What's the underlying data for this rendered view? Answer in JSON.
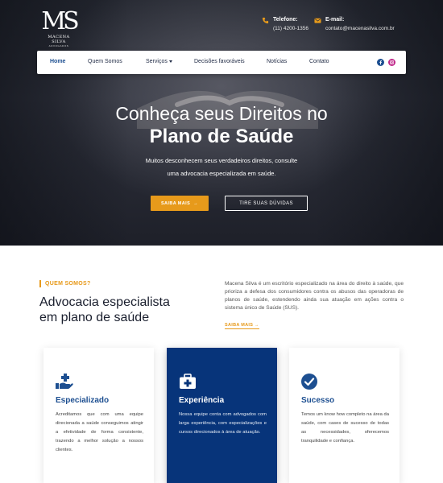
{
  "brand": {
    "mark": "MS",
    "name": "MACENA SILVA",
    "tagline": "ADVOGADOS"
  },
  "contacts": [
    {
      "label": "Telefone:",
      "value": "(11) 4200-1356",
      "icon": "phone-icon"
    },
    {
      "label": "E-mail:",
      "value": "contato@macenasilva.com.br",
      "icon": "mail-icon"
    }
  ],
  "nav": {
    "items": [
      "Home",
      "Quem Somos",
      "Serviços",
      "Decisões favoráveis",
      "Notícias",
      "Contato"
    ],
    "active": "Home",
    "social": [
      "facebook-icon",
      "instagram-icon"
    ]
  },
  "hero": {
    "title_line1": "Conheça seus Direitos no",
    "title_line2": "Plano de Saúde",
    "subtitle_line1": "Muitos desconhecem seus verdadeiros direitos, consulte",
    "subtitle_line2": "uma advocacia especializada em saúde.",
    "primary_cta": "SAIBA MAIS",
    "secondary_cta": "TIRE SUAS DÚVIDAS"
  },
  "about": {
    "eyebrow": "QUEM SOMOS?",
    "title_line1": "Advocacia especialista",
    "title_line2": "em plano de saúde",
    "text": "Macena Silva é um escritório especializado na área do direito à saúde, que prioriza a defesa dos consumidores contra os abusos das operadoras de planos de saúde, estendendo ainda sua atuação em ações contra o sistema único de Saúde (SUS).",
    "link": "SAIBA MAIS"
  },
  "features": [
    {
      "icon": "hand-care-icon",
      "title": "Especializado",
      "text": "Acreditamos que com uma equipe direcionada a saúde conseguimos atingir a efetividade de forma consistente, trazendo a melhor solução a nossos clientes."
    },
    {
      "icon": "medical-kit-icon",
      "title": "Experiência",
      "text": "Nossa equipe conta com advogados com larga experiência, com especializações e cursos direcionados à área de atuação."
    },
    {
      "icon": "check-circle-icon",
      "title": "Sucesso",
      "text": "Temos um know how completo na área da saúde, com cases de sucesso de todas as necessidades, oferecemos tranquilidade e confiança."
    }
  ],
  "colors": {
    "accent": "#e79a1b",
    "primary": "#07347a",
    "text_dark": "#1a1f2e"
  }
}
